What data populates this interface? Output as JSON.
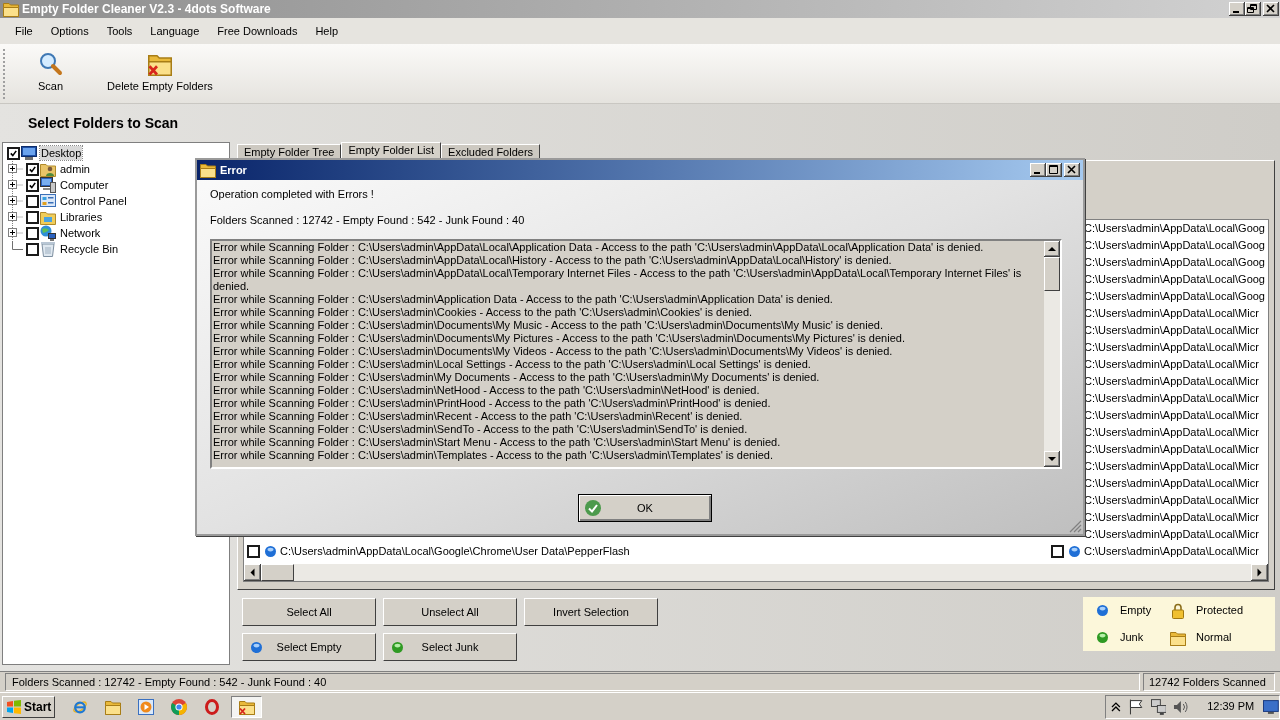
{
  "window": {
    "title": "Empty Folder Cleaner V2.3 - 4dots Software"
  },
  "menu": [
    "File",
    "Options",
    "Tools",
    "Language",
    "Free Downloads",
    "Help"
  ],
  "toolbar": [
    {
      "label": "Scan",
      "kind": "scan"
    },
    {
      "label": "Delete Empty Folders",
      "kind": "delete"
    }
  ],
  "folder_panel": {
    "heading": "Select Folders to Scan",
    "tree": [
      {
        "label": "Desktop",
        "kind": "desktop",
        "checked": true,
        "selected": true,
        "children": [
          {
            "label": "admin",
            "kind": "user",
            "checked": true,
            "selected": false,
            "expanded": false
          },
          {
            "label": "Computer",
            "kind": "computer",
            "checked": true,
            "selected": false,
            "expanded": false
          },
          {
            "label": "Control Panel",
            "kind": "control-panel",
            "checked": false,
            "selected": false,
            "expanded": false
          },
          {
            "label": "Libraries",
            "kind": "library",
            "checked": false,
            "selected": false,
            "expanded": false
          },
          {
            "label": "Network",
            "kind": "network",
            "checked": false,
            "selected": false,
            "expanded": false
          },
          {
            "label": "Recycle Bin",
            "kind": "recycle-bin",
            "checked": false,
            "selected": false
          }
        ]
      }
    ]
  },
  "tabs": [
    {
      "label": "Empty Folder Tree",
      "selected": false
    },
    {
      "label": "Empty Folder List",
      "selected": true
    },
    {
      "label": "Excluded Folders",
      "selected": false
    }
  ],
  "folder_list": {
    "column_1": [
      {
        "path": "C:\\Users\\admin\\AppData\\Local\\Google\\Chrome\\User Data\\PepperFlash",
        "checked": false,
        "kind": "empty"
      }
    ],
    "column_2": [
      {
        "path": "C:\\Users\\admin\\AppData\\Local\\Goog"
      },
      {
        "path": "C:\\Users\\admin\\AppData\\Local\\Goog"
      },
      {
        "path": "C:\\Users\\admin\\AppData\\Local\\Goog"
      },
      {
        "path": "C:\\Users\\admin\\AppData\\Local\\Goog"
      },
      {
        "path": "C:\\Users\\admin\\AppData\\Local\\Goog"
      },
      {
        "path": "C:\\Users\\admin\\AppData\\Local\\Micr"
      },
      {
        "path": "C:\\Users\\admin\\AppData\\Local\\Micr"
      },
      {
        "path": "C:\\Users\\admin\\AppData\\Local\\Micr"
      },
      {
        "path": "C:\\Users\\admin\\AppData\\Local\\Micr"
      },
      {
        "path": "C:\\Users\\admin\\AppData\\Local\\Micr"
      },
      {
        "path": "C:\\Users\\admin\\AppData\\Local\\Micr"
      },
      {
        "path": "C:\\Users\\admin\\AppData\\Local\\Micr"
      },
      {
        "path": "C:\\Users\\admin\\AppData\\Local\\Micr"
      },
      {
        "path": "C:\\Users\\admin\\AppData\\Local\\Micr"
      },
      {
        "path": "C:\\Users\\admin\\AppData\\Local\\Micr"
      },
      {
        "path": "C:\\Users\\admin\\AppData\\Local\\Micr"
      },
      {
        "path": "C:\\Users\\admin\\AppData\\Local\\Micr"
      },
      {
        "path": "C:\\Users\\admin\\AppData\\Local\\Micr"
      },
      {
        "path": "C:\\Users\\admin\\AppData\\Local\\Micr"
      },
      {
        "path": "C:\\Users\\admin\\AppData\\Local\\Micr",
        "checked": false,
        "kind": "empty"
      }
    ]
  },
  "selection_buttons": [
    {
      "label": "Select All",
      "kind": "plain"
    },
    {
      "label": "Unselect All",
      "kind": "plain"
    },
    {
      "label": "Invert Selection",
      "kind": "plain"
    },
    {
      "label": "Select Empty",
      "kind": "empty"
    },
    {
      "label": "Select Junk",
      "kind": "junk"
    }
  ],
  "legend": [
    {
      "label": "Empty",
      "kind": "empty"
    },
    {
      "label": "Protected",
      "kind": "protected"
    },
    {
      "label": "Junk",
      "kind": "junk"
    },
    {
      "label": "Normal",
      "kind": "normal"
    }
  ],
  "status_bar": {
    "summary": "Folders Scanned : 12742 - Empty Found : 542 - Junk Found : 40",
    "count": "12742 Folders Scanned"
  },
  "taskbar": {
    "start": "Start",
    "tasks": [
      {
        "selected": true
      }
    ],
    "clock": "12:39 PM"
  },
  "error_dialog": {
    "title": "Error",
    "message": "Operation completed with Errors !",
    "summary": "Folders Scanned : 12742 - Empty Found : 542 - Junk Found : 40",
    "log": [
      "Error while Scanning Folder : C:\\Users\\admin\\AppData\\Local\\Application Data - Access to the path 'C:\\Users\\admin\\AppData\\Local\\Application Data' is denied.",
      "Error while Scanning Folder : C:\\Users\\admin\\AppData\\Local\\History - Access to the path 'C:\\Users\\admin\\AppData\\Local\\History' is denied.",
      "Error while Scanning Folder : C:\\Users\\admin\\AppData\\Local\\Temporary Internet Files - Access to the path 'C:\\Users\\admin\\AppData\\Local\\Temporary Internet Files' is denied.",
      "Error while Scanning Folder : C:\\Users\\admin\\Application Data - Access to the path 'C:\\Users\\admin\\Application Data' is denied.",
      "Error while Scanning Folder : C:\\Users\\admin\\Cookies - Access to the path 'C:\\Users\\admin\\Cookies' is denied.",
      "Error while Scanning Folder : C:\\Users\\admin\\Documents\\My Music - Access to the path 'C:\\Users\\admin\\Documents\\My Music' is denied.",
      "Error while Scanning Folder : C:\\Users\\admin\\Documents\\My Pictures - Access to the path 'C:\\Users\\admin\\Documents\\My Pictures' is denied.",
      "Error while Scanning Folder : C:\\Users\\admin\\Documents\\My Videos - Access to the path 'C:\\Users\\admin\\Documents\\My Videos' is denied.",
      "Error while Scanning Folder : C:\\Users\\admin\\Local Settings - Access to the path 'C:\\Users\\admin\\Local Settings' is denied.",
      "Error while Scanning Folder : C:\\Users\\admin\\My Documents - Access to the path 'C:\\Users\\admin\\My Documents' is denied.",
      "Error while Scanning Folder : C:\\Users\\admin\\NetHood - Access to the path 'C:\\Users\\admin\\NetHood' is denied.",
      "Error while Scanning Folder : C:\\Users\\admin\\PrintHood - Access to the path 'C:\\Users\\admin\\PrintHood' is denied.",
      "Error while Scanning Folder : C:\\Users\\admin\\Recent - Access to the path 'C:\\Users\\admin\\Recent' is denied.",
      "Error while Scanning Folder : C:\\Users\\admin\\SendTo - Access to the path 'C:\\Users\\admin\\SendTo' is denied.",
      "Error while Scanning Folder : C:\\Users\\admin\\Start Menu - Access to the path 'C:\\Users\\admin\\Start Menu' is denied.",
      "Error while Scanning Folder : C:\\Users\\admin\\Templates - Access to the path 'C:\\Users\\admin\\Templates' is denied."
    ],
    "button": "OK"
  }
}
